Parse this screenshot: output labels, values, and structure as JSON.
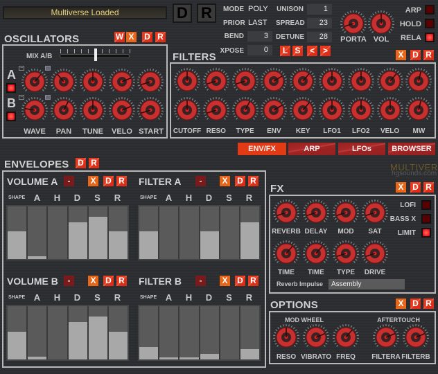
{
  "header": {
    "status_text": "Multiverse Loaded",
    "d_button": "D",
    "r_button": "R"
  },
  "global": {
    "mode_label": "MODE",
    "mode_value": "POLY",
    "prior_label": "PRIOR",
    "prior_value": "LAST",
    "bend_label": "BEND",
    "bend_value": "3",
    "xpose_label": "XPOSE",
    "xpose_value": "0",
    "unison_label": "UNISON",
    "unison_value": "1",
    "spread_label": "SPREAD",
    "spread_value": "23",
    "detune_label": "DETUNE",
    "detune_value": "28",
    "nav_buttons": [
      "L",
      "S",
      "<",
      ">"
    ],
    "knobs": [
      {
        "label": "PORTA",
        "value": 0.1
      },
      {
        "label": "VOL",
        "value": 0.5
      }
    ],
    "toggles": [
      {
        "label": "ARP",
        "on": false
      },
      {
        "label": "HOLD",
        "on": false
      },
      {
        "label": "RELA",
        "on": true
      }
    ],
    "xdr": [
      "X",
      "D",
      "R"
    ]
  },
  "oscillators": {
    "title": "OSCILLATORS",
    "buttons": [
      "W",
      "X",
      "D",
      "R"
    ],
    "mix_label": "MIX A/B",
    "mix_value": 0.5,
    "rows": [
      {
        "label": "A",
        "enabled": true,
        "knobs": [
          0.65,
          0.35,
          0.5,
          0.75,
          0.1
        ]
      },
      {
        "label": "B",
        "enabled": true,
        "knobs": [
          0.2,
          0.6,
          0.5,
          0.75,
          0.1
        ]
      }
    ],
    "knob_labels": [
      "WAVE",
      "PAN",
      "TUNE",
      "VELO",
      "START"
    ]
  },
  "filters": {
    "title": "FILTERS",
    "buttons": [
      "X",
      "D",
      "R"
    ],
    "rows": [
      [
        0.5,
        0.1,
        0.1,
        0.72,
        0.65,
        0.5,
        0.5,
        0.65,
        0.55
      ],
      [
        0.5,
        0.1,
        0.6,
        0.72,
        0.65,
        0.5,
        0.5,
        0.5,
        0.55
      ]
    ],
    "knob_labels": [
      "CUTOFF",
      "RESO",
      "TYPE",
      "ENV",
      "KEY",
      "LFO1",
      "LFO2",
      "VELO",
      "MW"
    ]
  },
  "tabs": [
    {
      "label": "ENV/FX",
      "active": true
    },
    {
      "label": "ARP",
      "active": false
    },
    {
      "label": "LFOs",
      "active": false
    },
    {
      "label": "BROWSER",
      "active": false
    }
  ],
  "logo": {
    "line1": "MULTIVERSE",
    "line2": "hgsounds.com"
  },
  "envelopes": {
    "title": "ENVELOPES",
    "buttons": [
      "D",
      "R"
    ],
    "shape_label": "SHAPE",
    "stage_labels": [
      "A",
      "H",
      "D",
      "S",
      "R"
    ],
    "minus_label": "-",
    "env_buttons": [
      "X",
      "D",
      "R"
    ],
    "items": [
      {
        "title": "VOLUME A",
        "values": [
          0.52,
          0.05,
          0.0,
          0.7,
          0.8,
          0.52
        ]
      },
      {
        "title": "FILTER A",
        "values": [
          0.52,
          0.0,
          0.0,
          0.52,
          0.0,
          0.7
        ]
      },
      {
        "title": "VOLUME B",
        "values": [
          0.52,
          0.05,
          0.0,
          0.7,
          0.8,
          0.52
        ]
      },
      {
        "title": "FILTER B",
        "values": [
          0.24,
          0.04,
          0.04,
          0.1,
          0.0,
          0.2
        ]
      }
    ]
  },
  "fx": {
    "title": "FX",
    "buttons": [
      "X",
      "D",
      "R"
    ],
    "row1": [
      {
        "label": "REVERB",
        "value": 0.1
      },
      {
        "label": "DELAY",
        "value": 0.1
      },
      {
        "label": "MOD",
        "value": 0.1
      },
      {
        "label": "SAT",
        "value": 0.1
      }
    ],
    "row2": [
      {
        "label": "TIME",
        "value": 0.65
      },
      {
        "label": "TIME",
        "value": 0.65
      },
      {
        "label": "TYPE",
        "value": 0.1
      },
      {
        "label": "DRIVE",
        "value": 0.1
      }
    ],
    "toggles": [
      {
        "label": "LOFI",
        "on": false
      },
      {
        "label": "BASS X",
        "on": false
      },
      {
        "label": "LIMIT",
        "on": true
      }
    ],
    "impulse_label": "Reverb Impulse",
    "impulse_value": "Assembly"
  },
  "options": {
    "title": "OPTIONS",
    "buttons": [
      "X",
      "D",
      "R"
    ],
    "mod_wheel_label": "MOD WHEEL",
    "aftertouch_label": "AFTERTOUCH",
    "knobs": [
      {
        "label": "RESO",
        "value": 0.5
      },
      {
        "label": "VIBRATO",
        "value": 0.75
      },
      {
        "label": "FREQ",
        "value": 0.65
      },
      {
        "label": "FILTERA",
        "value": 0.75
      },
      {
        "label": "FILTERB",
        "value": 0.75
      }
    ]
  }
}
